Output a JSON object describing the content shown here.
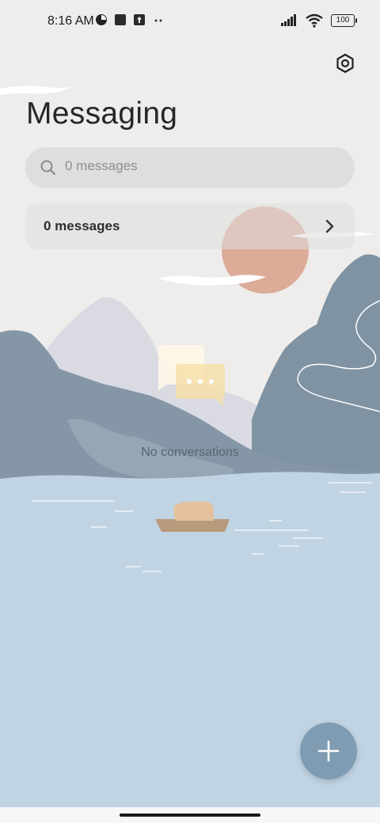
{
  "status_bar": {
    "time": "8:16 AM",
    "battery": "100",
    "icons": [
      "data-saver-icon",
      "notification-square-icon",
      "upload-icon",
      "more-dots-icon",
      "signal-icon",
      "wifi-icon",
      "battery-icon"
    ]
  },
  "header": {
    "title": "Messaging",
    "settings_icon": "hexagon-settings-icon"
  },
  "search": {
    "placeholder": "0 messages"
  },
  "summary": {
    "label": "0 messages"
  },
  "empty_state": {
    "text": "No conversations",
    "icon": "chat-bubbles-icon"
  },
  "fab": {
    "icon": "plus-icon"
  },
  "colors": {
    "background": "#eeedeb",
    "water": "#c0d4e4",
    "mountain_dark": "#7f93a3",
    "mountain_light": "#d8d9e1",
    "sun": "#d9a490",
    "fab": "#7f9cb2"
  }
}
